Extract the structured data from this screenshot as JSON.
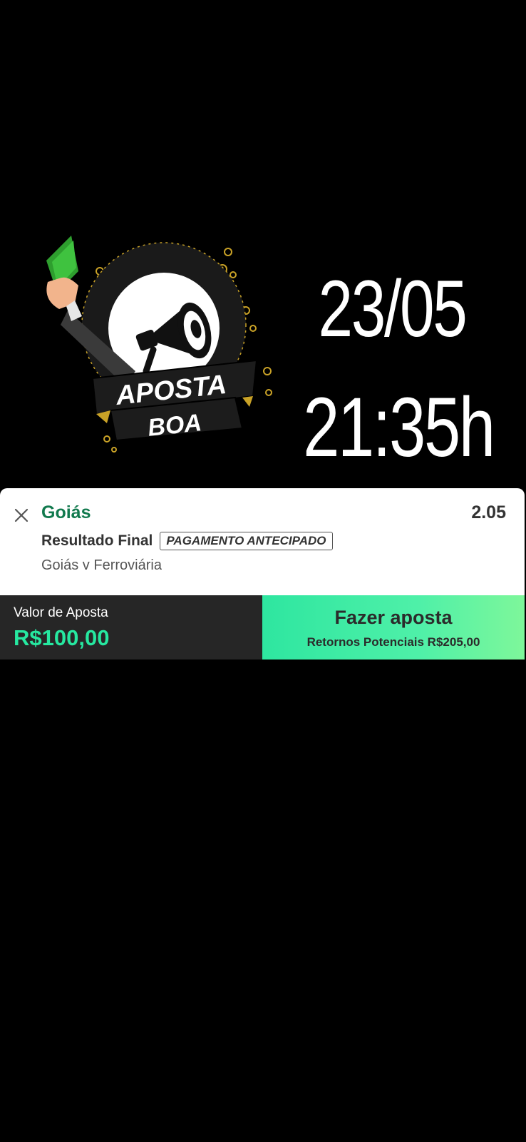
{
  "promo": {
    "logo": {
      "line1": "APOSTA",
      "line2": "BOA",
      "icon": "megaphone-icon"
    },
    "date": "23/05",
    "time": "21:35h"
  },
  "betslip": {
    "selection": "Goiás",
    "odds": "2.05",
    "market": "Resultado Final",
    "badge": "PAGAMENTO ANTECIPADO",
    "event": "Goiás v Ferroviária"
  },
  "footer": {
    "stake_label": "Valor de Aposta",
    "stake_value": "R$100,00",
    "bet_button_label": "Fazer aposta",
    "returns_text": "Retornos Potenciais R$205,00"
  },
  "colors": {
    "brand_green": "#127a4e",
    "accent_green": "#26e8a0",
    "stake_bar": "#262626"
  }
}
